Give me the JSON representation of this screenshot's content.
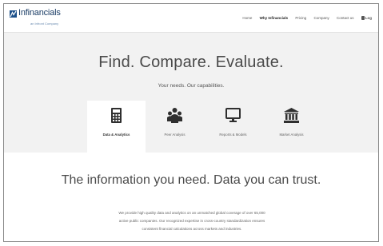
{
  "brand": {
    "name": "Infinancials",
    "tagline": "an Infront Company"
  },
  "nav": {
    "items": [
      "Home",
      "Why Infinancials",
      "Pricing",
      "Company",
      "Contact us"
    ],
    "login": "Log"
  },
  "hero": {
    "title": "Find. Compare. Evaluate.",
    "subtitle": "Your needs. Our capabilities.",
    "capabilities": [
      {
        "label": "Data & Analytics",
        "icon": "calculator-icon",
        "active": true
      },
      {
        "label": "Peer Analysis",
        "icon": "people-icon",
        "active": false
      },
      {
        "label": "Reports & Models",
        "icon": "monitor-icon",
        "active": false
      },
      {
        "label": "Market Analysis",
        "icon": "bank-icon",
        "active": false
      }
    ]
  },
  "main": {
    "headline": "The information you need. Data you can trust.",
    "description": [
      "We provide high quality data and analytics on an unmatched global coverage of over 65,000",
      "active public companies. Our recognized expertise in cross-country standardization ensures",
      "consistent financial calculations across markets and industries."
    ]
  },
  "colors": {
    "brand": "#1b4f8a",
    "hero_bg": "#f2f2f2",
    "icon": "#2f2f2f"
  }
}
